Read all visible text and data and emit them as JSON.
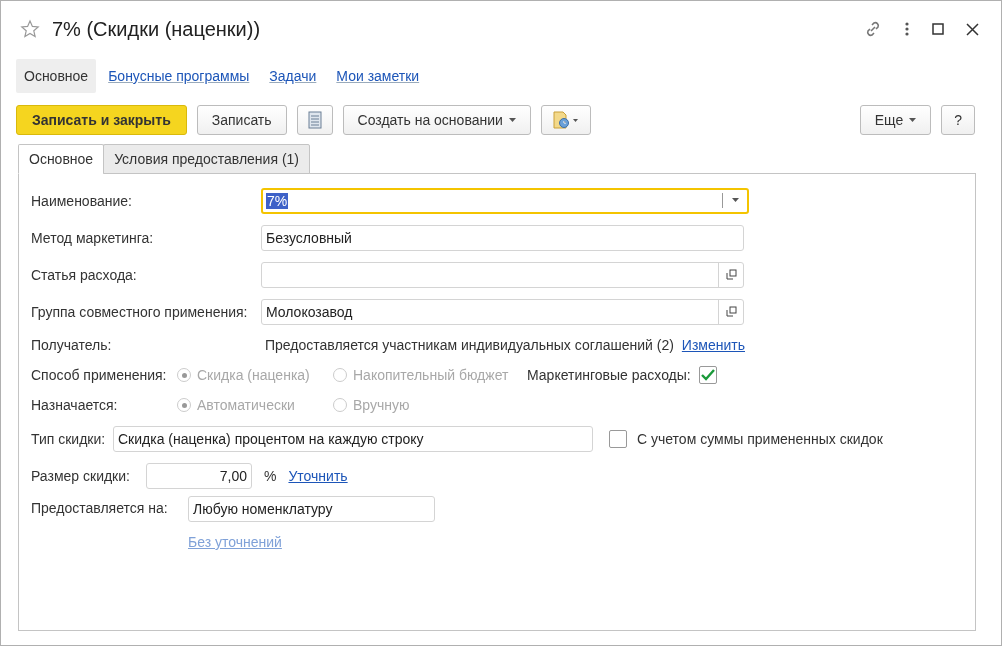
{
  "window": {
    "title": "7% (Скидки (наценки))"
  },
  "nav": [
    {
      "label": "Основное",
      "selected": true
    },
    {
      "label": "Бонусные программы",
      "selected": false
    },
    {
      "label": "Задачи",
      "selected": false
    },
    {
      "label": "Мои заметки",
      "selected": false
    }
  ],
  "toolbar": {
    "primary": "Записать и закрыть",
    "save": "Записать",
    "create_based": "Создать на основании",
    "more": "Еще",
    "help": "?"
  },
  "tabs": [
    {
      "label": "Основное",
      "selected": true
    },
    {
      "label": "Условия предоставления (1)",
      "selected": false
    }
  ],
  "form": {
    "name": {
      "label": "Наименование:",
      "value": "7%"
    },
    "method": {
      "label": "Метод маркетинга:",
      "value": "Безусловный"
    },
    "expense": {
      "label": "Статья расхода:"
    },
    "group": {
      "label": "Группа совместного применения:",
      "value": "Молокозавод"
    },
    "recipient": {
      "label": "Получатель:",
      "text": "Предоставляется участникам индивидуальных соглашений (2)",
      "link": "Изменить"
    },
    "application": {
      "label": "Способ применения:",
      "disabled": true,
      "options": [
        {
          "label": "Скидка (наценка)",
          "selected": true
        },
        {
          "label": "Накопительный бюджет",
          "selected": false
        }
      ],
      "marketing_label": "Маркетинговые расходы:",
      "marketing_checked": true
    },
    "assigned": {
      "label": "Назначается:",
      "disabled": true,
      "options": [
        {
          "label": "Автоматически",
          "selected": true
        },
        {
          "label": "Вручную",
          "selected": false
        }
      ]
    },
    "discount_type": {
      "label": "Тип скидки:",
      "value": "Скидка (наценка) процентом на каждую строку",
      "checkbox_label": "С учетом суммы примененных скидок",
      "checked": false
    },
    "size": {
      "label": "Размер скидки:",
      "value": "7,00",
      "unit": "%",
      "link": "Уточнить"
    },
    "applies_to": {
      "label": "Предоставляется на:",
      "value": "Любую номенклатуру",
      "link": "Без уточнений"
    }
  }
}
